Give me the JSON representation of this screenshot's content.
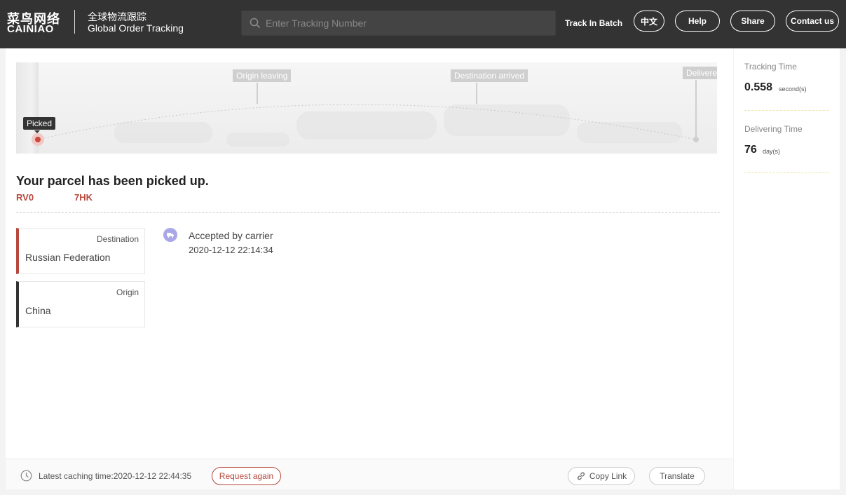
{
  "header": {
    "logo_cn": "菜鸟网络",
    "logo_en": "CAINIAO",
    "subtitle_cn": "全球物流跟踪",
    "subtitle_en": "Global Order Tracking",
    "search_placeholder": "Enter Tracking Number",
    "search_value": "",
    "track_batch_label": "Track In Batch",
    "buttons": {
      "chinese": "中文",
      "help": "Help",
      "share": "Share",
      "contact": "Contact us"
    }
  },
  "map": {
    "milestones": {
      "picked": "Picked",
      "origin_leaving": "Origin leaving",
      "destination_arrived": "Destination arrived",
      "delivered": "Delivere"
    }
  },
  "parcel": {
    "status": "Your parcel has been picked up.",
    "tracking_prefix": "RV0",
    "tracking_suffix": "7HK",
    "destination_label": "Destination",
    "destination_value": "Russian Federation",
    "origin_label": "Origin",
    "origin_value": "China"
  },
  "events": [
    {
      "title": "Accepted by carrier",
      "time": "2020-12-12 22:14:34"
    }
  ],
  "footer": {
    "cache_text": "Latest caching time:2020-12-12 22:44:35",
    "request_again": "Request again",
    "copy_link": "Copy Link",
    "translate": "Translate"
  },
  "side": {
    "tracking_time_label": "Tracking Time",
    "tracking_time_value": "0.558",
    "tracking_time_unit": "second(s)",
    "delivering_time_label": "Delivering Time",
    "delivering_time_value": "76",
    "delivering_time_unit": "day(s)"
  },
  "colors": {
    "header_bg": "#333333",
    "accent_red": "#b7483d",
    "event_icon": "#a9a7e8"
  }
}
